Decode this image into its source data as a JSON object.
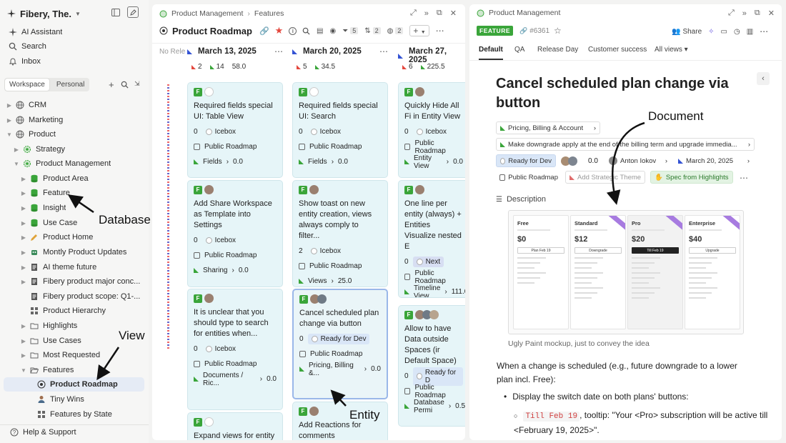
{
  "sidebar": {
    "workspace_name": "Fibery, The.",
    "nav": {
      "ai": "AI Assistant",
      "search": "Search",
      "inbox": "Inbox"
    },
    "tabs": {
      "workspace": "Workspace",
      "personal": "Personal"
    },
    "items": [
      {
        "label": "CRM",
        "icon": "globe-icon"
      },
      {
        "label": "Marketing",
        "icon": "globe-icon"
      },
      {
        "label": "Product",
        "icon": "globe-icon"
      },
      {
        "label": "Strategy",
        "icon": "gear-icon"
      },
      {
        "label": "Product Management",
        "icon": "gear-icon"
      },
      {
        "label": "Product Area",
        "icon": "database-icon"
      },
      {
        "label": "Feature",
        "icon": "database-icon"
      },
      {
        "label": "Insight",
        "icon": "database-icon"
      },
      {
        "label": "Use Case",
        "icon": "database-icon"
      },
      {
        "label": "Product Home",
        "icon": "pencil-icon"
      },
      {
        "label": "Montly Product Updates",
        "icon": "robot-icon"
      },
      {
        "label": "AI theme future",
        "icon": "document-icon"
      },
      {
        "label": "Fibery product major conc...",
        "icon": "document-icon"
      },
      {
        "label": "Fibery product scope: Q1-...",
        "icon": "document-icon"
      },
      {
        "label": "Product Hierarchy",
        "icon": "grid-icon"
      },
      {
        "label": "Highlights",
        "icon": "folder-icon"
      },
      {
        "label": "Use Cases",
        "icon": "folder-icon"
      },
      {
        "label": "Most Requested",
        "icon": "folder-icon"
      },
      {
        "label": "Features",
        "icon": "folder-open-icon"
      },
      {
        "label": "Product Roadmap",
        "icon": "target-icon"
      },
      {
        "label": "Tiny Wins",
        "icon": "person-icon"
      },
      {
        "label": "Features by State",
        "icon": "grid-icon"
      }
    ],
    "help": "Help & Support"
  },
  "board": {
    "breadcrumb": [
      "Product Management",
      "Features"
    ],
    "title": "Product Roadmap",
    "filter_count": "5",
    "sort_count": "2",
    "color_count": "2",
    "no_release": "No Rele",
    "columns": [
      {
        "date": "March 13, 2025",
        "s1": "2",
        "s2": "14",
        "s3": "58.0"
      },
      {
        "date": "March 20, 2025",
        "s1": "5",
        "s2": "34.5",
        "s3": ""
      },
      {
        "date": "March 27, 2025",
        "s1": "6",
        "s2": "225.5",
        "s3": ""
      }
    ],
    "cards": [
      {
        "title": "Required fields special UI: Table View",
        "num": "0",
        "status": "Icebox",
        "roadmap": "Public Roadmap",
        "area": "Fields",
        "est": "0.0"
      },
      {
        "title": "Required fields special UI: Search",
        "num": "0",
        "status": "Icebox",
        "roadmap": "Public Roadmap",
        "area": "Fields",
        "est": "0.0"
      },
      {
        "title": "Quickly Hide All Fi in Entity View",
        "num": "0",
        "status": "Icebox",
        "roadmap": "Public Roadmap",
        "area": "Entity View",
        "est": "0.0"
      },
      {
        "title": "Add Share Workspace as Template into Settings",
        "num": "0",
        "status": "Icebox",
        "roadmap": "Public Roadmap",
        "area": "Sharing",
        "est": "0.0"
      },
      {
        "title": "Show toast on new entity creation, views always comply to filter...",
        "num": "2",
        "status": "Icebox",
        "roadmap": "Public Roadmap",
        "area": "Views",
        "est": "25.0"
      },
      {
        "title": "One line per entity (always) + Entities Visualize nested E",
        "num": "0",
        "status": "Next",
        "roadmap": "Public Roadmap",
        "area": "Timeline View",
        "est": "111.0"
      },
      {
        "title": "It is unclear that you should type to search for entities when...",
        "num": "0",
        "status": "Icebox",
        "roadmap": "Public Roadmap",
        "area": "Documents / Ric...",
        "est": "0.0"
      },
      {
        "title": "Cancel scheduled plan change via button",
        "num": "0",
        "status": "Ready for Dev",
        "roadmap": "Public Roadmap",
        "area": "Pricing, Billing &...",
        "est": "0.0"
      },
      {
        "title": "Allow to have Data outside Spaces (ir Default Space)",
        "num": "0",
        "status": "Ready for D",
        "roadmap": "Public Roadmap",
        "area": "Database Permi",
        "est": "0.5"
      },
      {
        "title": "Expand views for entity",
        "num": "",
        "status": "",
        "roadmap": "",
        "area": "",
        "est": ""
      },
      {
        "title": "Add Reactions for comments",
        "num": "",
        "status": "",
        "roadmap": "",
        "area": "",
        "est": ""
      }
    ]
  },
  "doc": {
    "breadcrumb": "Product Management",
    "badge": "FEATURE",
    "id": "#6361",
    "share": "Share",
    "tabs": [
      "Default",
      "QA",
      "Release Day",
      "Customer success",
      "All views"
    ],
    "title": "Cancel scheduled plan change via button",
    "fields": {
      "area": "Pricing, Billing & Account",
      "parent": "Make downgrade apply at the end of the billing term and upgrade immedia...",
      "state": "Ready for Dev",
      "est": "0.0",
      "owner": "Anton Iokov",
      "release": "March 20, 2025",
      "roadmap": "Public Roadmap",
      "theme": "Add Strategic Theme",
      "spec": "Spec from Highlights"
    },
    "description_label": "Description",
    "mockup": {
      "plans": [
        {
          "name": "Free",
          "price": "$0",
          "btn": "Plan Feb 19"
        },
        {
          "name": "Standard",
          "price": "$12",
          "btn": "Downgrade"
        },
        {
          "name": "Pro",
          "price": "$20",
          "btn": "Till Feb 19"
        },
        {
          "name": "Enterprise",
          "price": "$40",
          "btn": "Upgrade"
        }
      ]
    },
    "caption": "Ugly Paint mockup, just to convey the idea",
    "para": "When a change is scheduled (e.g., future downgrade to a lower plan incl. Free):",
    "bullet": "Display the switch date on both plans' buttons:",
    "code": "Till Feb 19",
    "subbullet": ", tooltip: \"Your <Pro> subscription will be active till <February 19, 2025>\"."
  },
  "annotations": {
    "database": "Database",
    "view": "View",
    "document": "Document",
    "entity": "Entity"
  },
  "colors": {
    "accent": "#3aa53a",
    "card": "#e6f5f8",
    "selected": "#e5ebf5"
  }
}
